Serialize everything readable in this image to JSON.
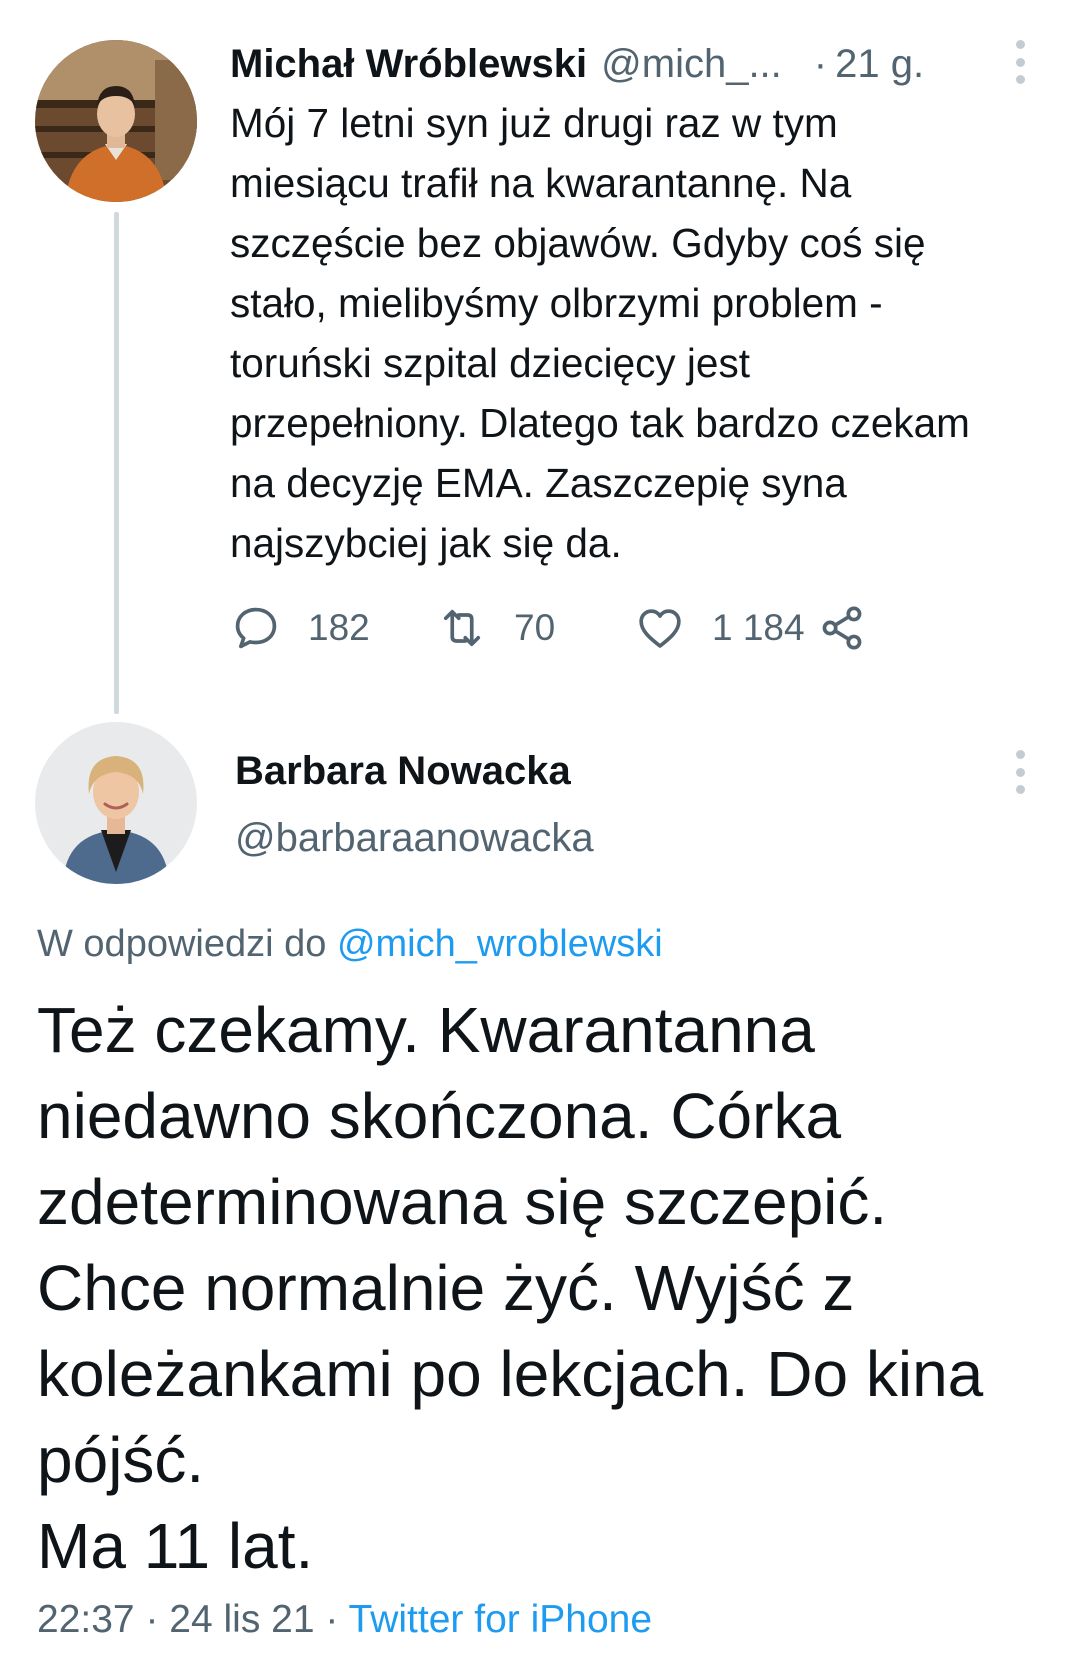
{
  "tweet1": {
    "author_name": "Michał Wróblewski",
    "author_handle": "@mich_...",
    "separator": "·",
    "time": "21 g.",
    "body": "Mój 7 letni syn już drugi raz w tym\nmiesiącu trafił na kwarantannę. Na\nszczęście bez objawów. Gdyby coś się\nstało, mielibyśmy olbrzymi problem -\ntoruński szpital dziecięcy jest\nprzepełniony. Dlatego tak bardzo czekam\nna decyzję EMA. Zaszczepię syna\nnajszybciej jak się da.",
    "actions": {
      "reply_icon": "comment-bubble-icon",
      "reply_count": "182",
      "retweet_icon": "retweet-icon",
      "retweet_count": "70",
      "like_icon": "heart-icon",
      "like_count": "1 184",
      "share_icon": "share-icon"
    }
  },
  "tweet2": {
    "author_name": "Barbara Nowacka",
    "author_handle": "@barbaraanowacka",
    "reply_to_prefix": "W odpowiedzi do",
    "reply_to_handle": "@mich_wroblewski",
    "body": "Też czekamy. Kwarantanna\nniedawno skończona. Córka\nzdeterminowana się szczepić.\nChce normalnie żyć. Wyjść z\nkoleżankami po lekcjach. Do kina\npójść.\nMa 11 lat.",
    "time": "22:37",
    "date": "24 lis 21",
    "separator": "·",
    "source": "Twitter for iPhone"
  },
  "colors": {
    "text": "#0f1419",
    "secondary": "#536471",
    "link": "#1d9bf0",
    "thread_line": "#cfd9de"
  }
}
